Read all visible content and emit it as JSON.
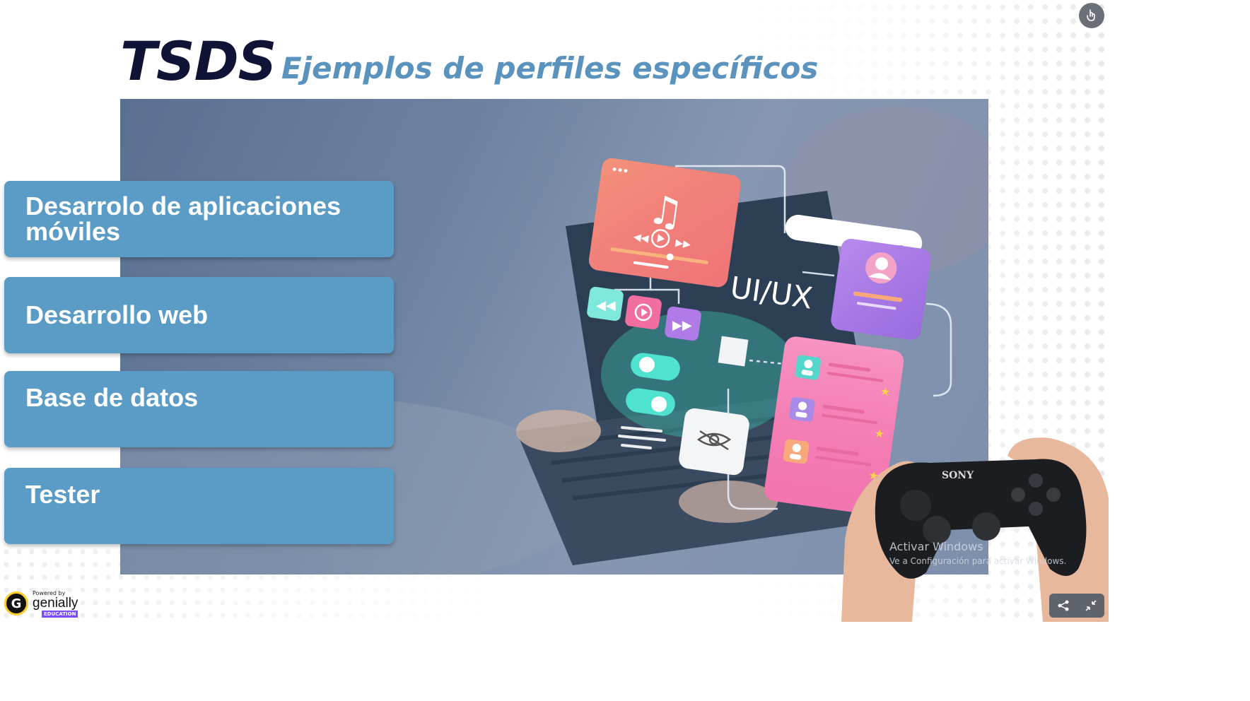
{
  "header": {
    "brand": "TSDS",
    "subtitle": "Ejemplos de perfiles específicos"
  },
  "cards": [
    {
      "line1": "Desarrolo de aplicaciones",
      "line2": "móviles"
    },
    {
      "line1": "Desarrollo web",
      "line2": ""
    },
    {
      "line1": "Base de datos",
      "line2": ""
    },
    {
      "line1": "Tester",
      "line2": ""
    }
  ],
  "illustration": {
    "uiux_label": "UI/UX",
    "controller_brand": "SONY"
  },
  "watermark": {
    "line1": "Activar Windows",
    "line2": "Ve a Configuración para activar Windows."
  },
  "footer": {
    "powered_by": "Powered by",
    "brand": "genially",
    "edition": "EDUCATION"
  },
  "icons": [
    "touch-icon",
    "share-icon",
    "collapse-icon",
    "genially-logo-icon",
    "search-icon",
    "music-note-icon",
    "play-icon",
    "rewind-icon",
    "forward-icon",
    "eye-hidden-icon"
  ],
  "colors": {
    "card_bg": "#5b9cc7",
    "brand_text": "#0f1436",
    "subtitle_text": "#5b93bf",
    "hero_overlay": "#6d83a0"
  }
}
